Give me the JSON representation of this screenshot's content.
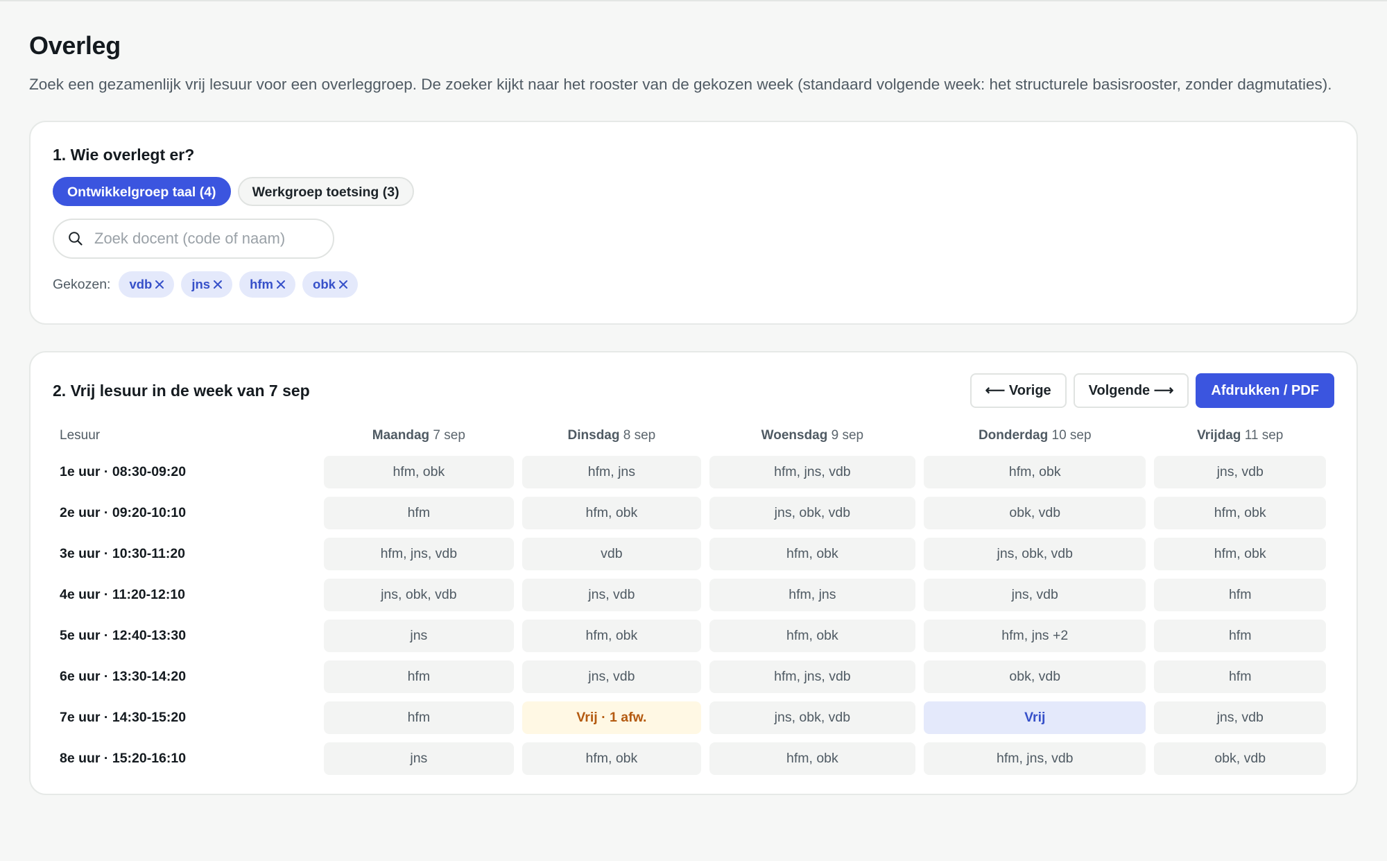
{
  "page": {
    "title": "Overleg",
    "intro": "Zoek een gezamenlijk vrij lesuur voor een overleggroep. De zoeker kijkt naar het rooster van de gekozen week (standaard volgende week: het structurele basisrooster, zonder dagmutaties)."
  },
  "step1": {
    "heading": "1. Wie overlegt er?",
    "groups": [
      {
        "label": "Ontwikkelgroep taal (4)",
        "active": true
      },
      {
        "label": "Werkgroep toetsing (3)",
        "active": false
      }
    ],
    "search_placeholder": "Zoek docent (code of naam)",
    "search_value": "",
    "chosen_label": "Gekozen:",
    "chosen": [
      "vdb",
      "jns",
      "hfm",
      "obk"
    ]
  },
  "step2": {
    "heading": "2. Vrij lesuur in de week van 7 sep",
    "prev_label": "⟵ Vorige",
    "next_label": "Volgende ⟶",
    "print_label": "Afdrukken / PDF",
    "period_header": "Lesuur",
    "days": [
      {
        "name": "Maandag",
        "date": "7 sep"
      },
      {
        "name": "Dinsdag",
        "date": "8 sep"
      },
      {
        "name": "Woensdag",
        "date": "9 sep"
      },
      {
        "name": "Donderdag",
        "date": "10 sep"
      },
      {
        "name": "Vrijdag",
        "date": "11 sep"
      }
    ],
    "rows": [
      {
        "period": "1e uur · 08:30-09:20",
        "cells": [
          {
            "text": "hfm, obk"
          },
          {
            "text": "hfm, jns"
          },
          {
            "text": "hfm, jns, vdb"
          },
          {
            "text": "hfm, obk"
          },
          {
            "text": "jns, vdb"
          }
        ]
      },
      {
        "period": "2e uur · 09:20-10:10",
        "cells": [
          {
            "text": "hfm"
          },
          {
            "text": "hfm, obk"
          },
          {
            "text": "jns, obk, vdb"
          },
          {
            "text": "obk, vdb"
          },
          {
            "text": "hfm, obk"
          }
        ]
      },
      {
        "period": "3e uur · 10:30-11:20",
        "cells": [
          {
            "text": "hfm, jns, vdb"
          },
          {
            "text": "vdb"
          },
          {
            "text": "hfm, obk"
          },
          {
            "text": "jns, obk, vdb"
          },
          {
            "text": "hfm, obk"
          }
        ]
      },
      {
        "period": "4e uur · 11:20-12:10",
        "cells": [
          {
            "text": "jns, obk, vdb"
          },
          {
            "text": "jns, vdb"
          },
          {
            "text": "hfm, jns"
          },
          {
            "text": "jns, vdb"
          },
          {
            "text": "hfm"
          }
        ]
      },
      {
        "period": "5e uur · 12:40-13:30",
        "cells": [
          {
            "text": "jns"
          },
          {
            "text": "hfm, obk"
          },
          {
            "text": "hfm, obk"
          },
          {
            "text": "hfm, jns +2"
          },
          {
            "text": "hfm"
          }
        ]
      },
      {
        "period": "6e uur · 13:30-14:20",
        "cells": [
          {
            "text": "hfm"
          },
          {
            "text": "jns, vdb"
          },
          {
            "text": "hfm, jns, vdb"
          },
          {
            "text": "obk, vdb"
          },
          {
            "text": "hfm"
          }
        ]
      },
      {
        "period": "7e uur · 14:30-15:20",
        "cells": [
          {
            "text": "hfm"
          },
          {
            "text": "Vrij · 1 afw.",
            "status": "warn"
          },
          {
            "text": "jns, obk, vdb"
          },
          {
            "text": "Vrij",
            "status": "free"
          },
          {
            "text": "jns, vdb"
          }
        ]
      },
      {
        "period": "8e uur · 15:20-16:10",
        "cells": [
          {
            "text": "jns"
          },
          {
            "text": "hfm, obk"
          },
          {
            "text": "hfm, obk"
          },
          {
            "text": "hfm, jns, vdb"
          },
          {
            "text": "obk, vdb"
          }
        ]
      }
    ]
  },
  "colors": {
    "accent": "#3b55df",
    "free_bg": "#e4e9fb",
    "warn_bg": "#fff8e4",
    "warn_text": "#b45a10"
  },
  "icons": {
    "search": "search-icon",
    "remove": "close-icon"
  }
}
